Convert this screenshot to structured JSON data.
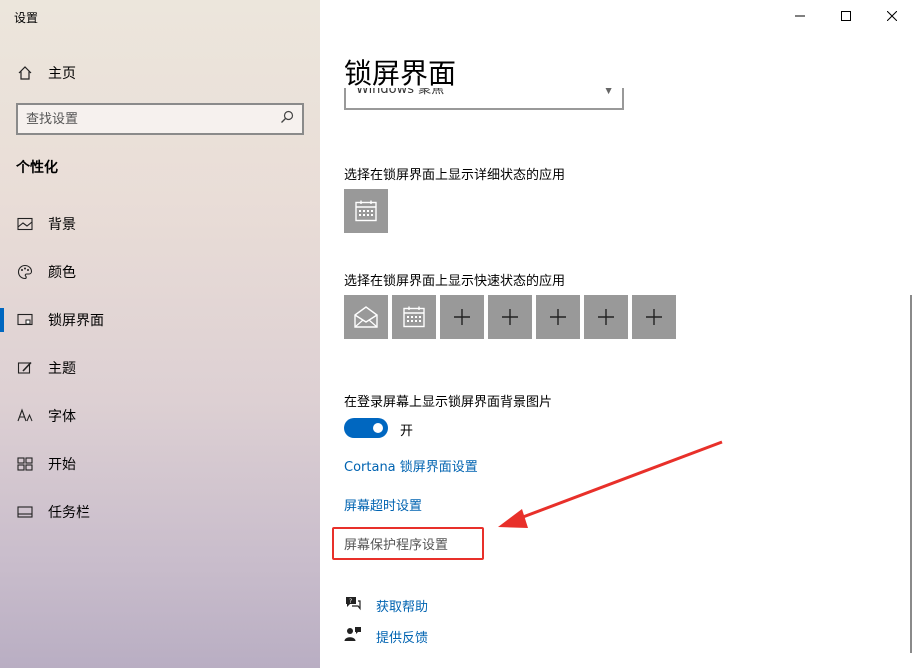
{
  "window": {
    "title": "设置"
  },
  "sidebar": {
    "home": "主页",
    "search_placeholder": "查找设置",
    "section": "个性化",
    "items": [
      {
        "label": "背景",
        "icon": "picture-icon"
      },
      {
        "label": "颜色",
        "icon": "palette-icon"
      },
      {
        "label": "锁屏界面",
        "icon": "lock-screen-icon",
        "active": true
      },
      {
        "label": "主题",
        "icon": "brush-icon"
      },
      {
        "label": "字体",
        "icon": "font-icon"
      },
      {
        "label": "开始",
        "icon": "start-icon"
      },
      {
        "label": "任务栏",
        "icon": "taskbar-icon"
      }
    ]
  },
  "main": {
    "title": "锁屏界面",
    "background_dropdown": "Windows 聚焦",
    "detailed_status_label": "选择在锁屏界面上显示详细状态的应用",
    "quick_status_label": "选择在锁屏界面上显示快速状态的应用",
    "signin_bg_label": "在登录屏幕上显示锁屏界面背景图片",
    "toggle_state": "开",
    "links": {
      "cortana": "Cortana 锁屏界面设置",
      "timeout": "屏幕超时设置",
      "screensaver": "屏幕保护程序设置"
    },
    "help": {
      "get_help": "获取帮助",
      "feedback": "提供反馈"
    }
  },
  "colors": {
    "accent": "#0067c0",
    "link": "#0063b1",
    "annotation": "#e8302a"
  }
}
